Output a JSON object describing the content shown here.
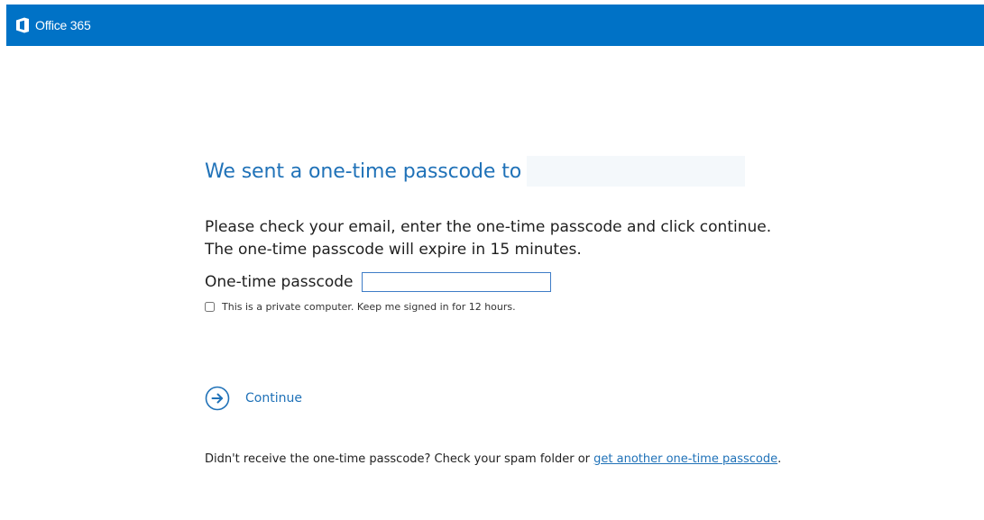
{
  "header": {
    "brand": "Office 365",
    "background_color": "#0072c6",
    "logo_icon": "office-logo-icon"
  },
  "main": {
    "heading": "We sent a one-time passcode to",
    "instructions": {
      "line1": "Please check your email, enter the one-time passcode and click continue.",
      "line2": "The one-time passcode will expire in 15 minutes."
    },
    "passcode": {
      "label": "One-time passcode",
      "value": ""
    },
    "keep_signed_in": {
      "label": "This is a private computer. Keep me signed in for 12 hours.",
      "checked": false
    },
    "continue": {
      "label": "Continue",
      "icon": "arrow-right-circle-icon"
    },
    "resend": {
      "prefix": "Didn't receive the one-time passcode? Check your spam folder or ",
      "link_text": "get another one-time passcode",
      "suffix": "."
    },
    "accent_color": "#2072b8"
  }
}
